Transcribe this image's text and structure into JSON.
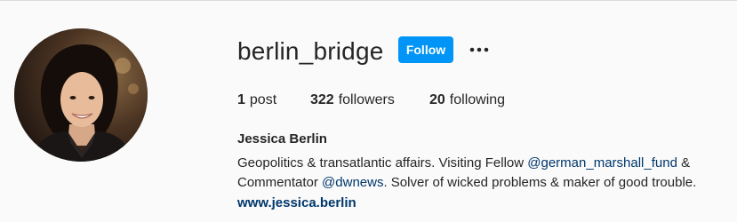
{
  "profile": {
    "username": "berlin_bridge",
    "follow_label": "Follow",
    "more_icon": "more-options-icon",
    "avatar_icon": "profile-photo",
    "stats": {
      "posts_count": "1",
      "posts_label": "post",
      "followers_count": "322",
      "followers_label": "followers",
      "following_count": "20",
      "following_label": "following"
    },
    "full_name": "Jessica Berlin",
    "bio": {
      "part1": "Geopolitics & transatlantic affairs. Visiting Fellow ",
      "mention1": "@german_marshall_fund",
      "part2": " & Commentator ",
      "mention2": "@dwnews",
      "part3": ". Solver of wicked problems & maker of good trouble."
    },
    "website": "www.jessica.berlin"
  },
  "colors": {
    "background": "#fafafa",
    "primary_text": "#262626",
    "follow_button": "#0095f6",
    "link": "#00376b"
  }
}
